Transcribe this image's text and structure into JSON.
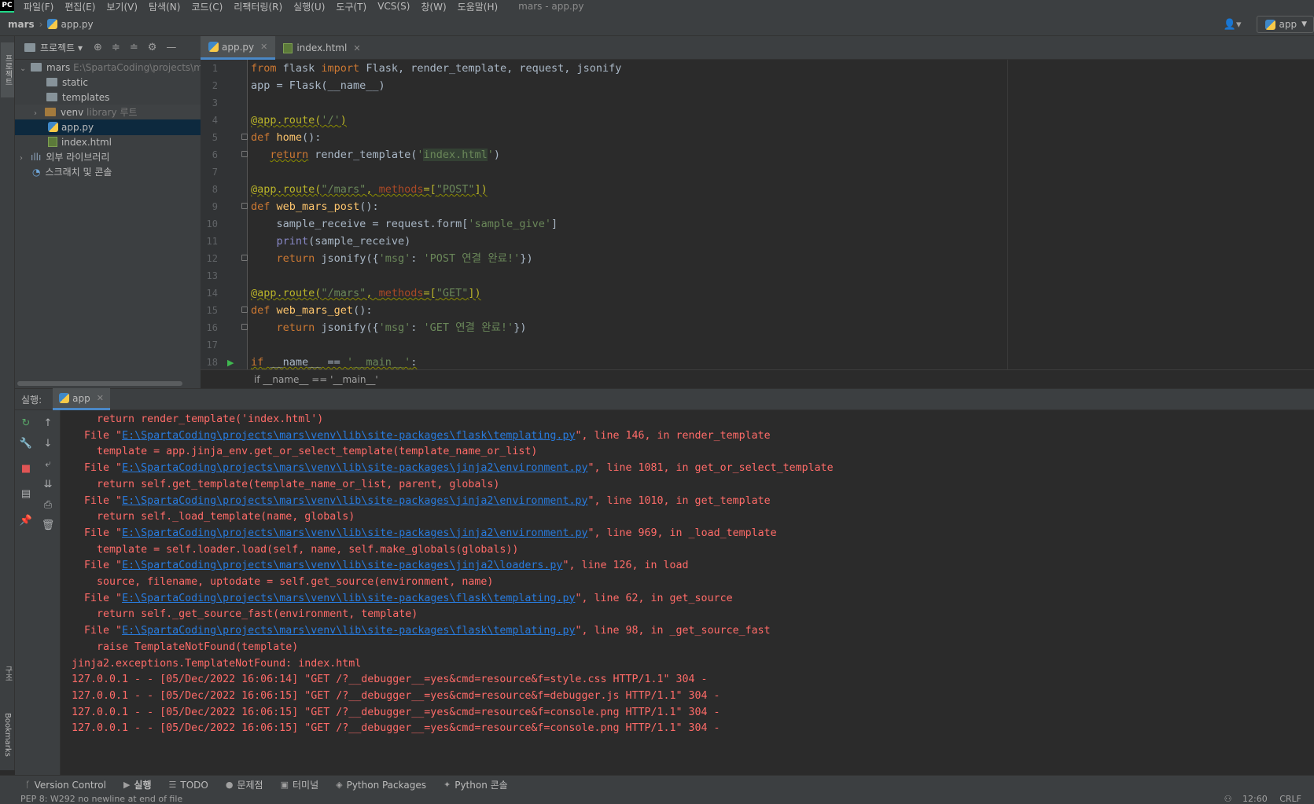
{
  "menubar": {
    "logo": "PC",
    "items": [
      "파일(F)",
      "편집(E)",
      "보기(V)",
      "탐색(N)",
      "코드(C)",
      "리팩터링(R)",
      "실행(U)",
      "도구(T)",
      "VCS(S)",
      "창(W)",
      "도움말(H)"
    ],
    "window_title": "mars - app.py"
  },
  "navbar": {
    "project": "mars",
    "file": "app.py",
    "run_config": "app"
  },
  "left_tool": {
    "project_tab": "프로젝트",
    "structure_tab": "구조",
    "bookmarks_tab": "Bookmarks"
  },
  "project_panel": {
    "title": "프로젝트",
    "tree": [
      {
        "label": "mars",
        "extra": "E:\\SpartaCoding\\projects\\m",
        "type": "folder",
        "expanded": true
      },
      {
        "label": "static",
        "extra": "",
        "type": "folder"
      },
      {
        "label": "templates",
        "extra": "",
        "type": "folder"
      },
      {
        "label": "venv",
        "extra": "library 루트",
        "type": "folder"
      },
      {
        "label": "app.py",
        "extra": "",
        "type": "py"
      },
      {
        "label": "index.html",
        "extra": "",
        "type": "html"
      },
      {
        "label": "외부 라이브러리",
        "extra": "",
        "type": "lib"
      },
      {
        "label": "스크래치 및 콘솔",
        "extra": "",
        "type": "scratch"
      }
    ]
  },
  "tabs": [
    {
      "label": "app.py",
      "active": true
    },
    {
      "label": "index.html",
      "active": false
    }
  ],
  "editor": {
    "line_numbers": [
      "1",
      "2",
      "3",
      "4",
      "5",
      "6",
      "7",
      "8",
      "9",
      "10",
      "11",
      "12",
      "13",
      "14",
      "15",
      "16",
      "17",
      "18"
    ],
    "breadcrumb": "if __name__ == '__main__'"
  },
  "run_panel": {
    "label": "실행:",
    "tab": "app"
  },
  "console": {
    "lines": [
      {
        "indent": "    ",
        "text": "return render_template('index.html')"
      },
      {
        "indent": "  ",
        "pre": "File \"",
        "link": "E:\\SpartaCoding\\projects\\mars\\venv\\lib\\site-packages\\flask\\templating.py",
        "post": "\", line 146, in render_template"
      },
      {
        "indent": "    ",
        "text": "template = app.jinja_env.get_or_select_template(template_name_or_list)"
      },
      {
        "indent": "  ",
        "pre": "File \"",
        "link": "E:\\SpartaCoding\\projects\\mars\\venv\\lib\\site-packages\\jinja2\\environment.py",
        "post": "\", line 1081, in get_or_select_template"
      },
      {
        "indent": "    ",
        "text": "return self.get_template(template_name_or_list, parent, globals)"
      },
      {
        "indent": "  ",
        "pre": "File \"",
        "link": "E:\\SpartaCoding\\projects\\mars\\venv\\lib\\site-packages\\jinja2\\environment.py",
        "post": "\", line 1010, in get_template"
      },
      {
        "indent": "    ",
        "text": "return self._load_template(name, globals)"
      },
      {
        "indent": "  ",
        "pre": "File \"",
        "link": "E:\\SpartaCoding\\projects\\mars\\venv\\lib\\site-packages\\jinja2\\environment.py",
        "post": "\", line 969, in _load_template"
      },
      {
        "indent": "    ",
        "text": "template = self.loader.load(self, name, self.make_globals(globals))"
      },
      {
        "indent": "  ",
        "pre": "File \"",
        "link": "E:\\SpartaCoding\\projects\\mars\\venv\\lib\\site-packages\\jinja2\\loaders.py",
        "post": "\", line 126, in load"
      },
      {
        "indent": "    ",
        "text": "source, filename, uptodate = self.get_source(environment, name)"
      },
      {
        "indent": "  ",
        "pre": "File \"",
        "link": "E:\\SpartaCoding\\projects\\mars\\venv\\lib\\site-packages\\flask\\templating.py",
        "post": "\", line 62, in get_source"
      },
      {
        "indent": "    ",
        "text": "return self._get_source_fast(environment, template)"
      },
      {
        "indent": "  ",
        "pre": "File \"",
        "link": "E:\\SpartaCoding\\projects\\mars\\venv\\lib\\site-packages\\flask\\templating.py",
        "post": "\", line 98, in _get_source_fast"
      },
      {
        "indent": "    ",
        "text": "raise TemplateNotFound(template)"
      },
      {
        "indent": "",
        "text": "jinja2.exceptions.TemplateNotFound: index.html"
      },
      {
        "indent": "",
        "text": "127.0.0.1 - - [05/Dec/2022 16:06:14] \"GET /?__debugger__=yes&cmd=resource&f=style.css HTTP/1.1\" 304 -"
      },
      {
        "indent": "",
        "text": "127.0.0.1 - - [05/Dec/2022 16:06:15] \"GET /?__debugger__=yes&cmd=resource&f=debugger.js HTTP/1.1\" 304 -"
      },
      {
        "indent": "",
        "text": "127.0.0.1 - - [05/Dec/2022 16:06:15] \"GET /?__debugger__=yes&cmd=resource&f=console.png HTTP/1.1\" 304 -"
      },
      {
        "indent": "",
        "text": "127.0.0.1 - - [05/Dec/2022 16:06:15] \"GET /?__debugger__=yes&cmd=resource&f=console.png HTTP/1.1\" 304 -"
      }
    ]
  },
  "statusbar": {
    "items": [
      {
        "icon": "branch-icon",
        "label": "Version Control"
      },
      {
        "icon": "run-icon",
        "label": "실행"
      },
      {
        "icon": "list-icon",
        "label": "TODO"
      },
      {
        "icon": "problems-icon",
        "label": "문제점"
      },
      {
        "icon": "terminal-icon",
        "label": "터미널"
      },
      {
        "icon": "packages-icon",
        "label": "Python Packages"
      },
      {
        "icon": "python-console-icon",
        "label": "Python 콘솔"
      }
    ],
    "message": "PEP 8: W292 no newline at end of file",
    "position": "12:60",
    "line_sep": "CRLF"
  },
  "colors": {
    "bg": "#2b2b2b",
    "panel": "#3c3f41",
    "keyword": "#cc7832",
    "string": "#6a8759",
    "error": "#ff6b68",
    "link": "#287bde",
    "accent": "#4a88c7"
  }
}
